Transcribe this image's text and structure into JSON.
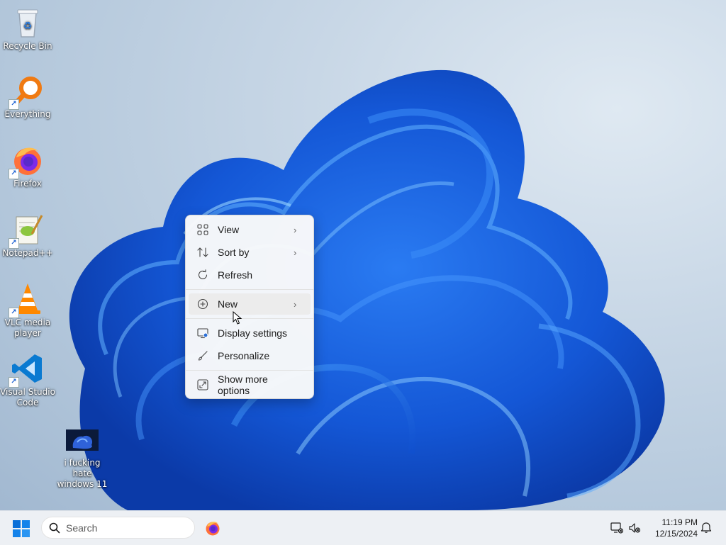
{
  "desktop": {
    "icons": [
      {
        "label": "Recycle Bin",
        "icon": "recycle-bin-icon"
      },
      {
        "label": "Everything",
        "icon": "everything-search-icon"
      },
      {
        "label": "Firefox",
        "icon": "firefox-icon"
      },
      {
        "label": "Notepad++",
        "icon": "notepad-plus-plus-icon"
      },
      {
        "label": "VLC media player",
        "icon": "vlc-icon"
      },
      {
        "label": "Visual Studio Code",
        "icon": "vscode-icon"
      },
      {
        "label": "i fucking hate windows 11",
        "icon": "image-file-icon"
      }
    ]
  },
  "context_menu": {
    "items": [
      {
        "label": "View",
        "icon": "view-grid-icon",
        "submenu": true
      },
      {
        "label": "Sort by",
        "icon": "sort-icon",
        "submenu": true
      },
      {
        "label": "Refresh",
        "icon": "refresh-icon",
        "submenu": false
      },
      {
        "label": "New",
        "icon": "new-plus-icon",
        "submenu": true,
        "highlighted": true
      },
      {
        "label": "Display settings",
        "icon": "display-settings-icon",
        "submenu": false
      },
      {
        "label": "Personalize",
        "icon": "personalize-brush-icon",
        "submenu": false
      },
      {
        "label": "Show more options",
        "icon": "show-more-options-icon",
        "submenu": false
      }
    ]
  },
  "taskbar": {
    "search_placeholder": "Search",
    "pinned": [
      {
        "name": "Firefox",
        "icon": "firefox-icon"
      }
    ],
    "tray": {
      "icons": [
        "network-icon",
        "volume-muted-icon",
        "notification-bell-icon"
      ]
    },
    "clock": {
      "time": "11:19 PM",
      "date": "12/15/2024"
    }
  },
  "colors": {
    "accent": "#0067c0",
    "wallpaper_bloom": "#1e63e6"
  }
}
